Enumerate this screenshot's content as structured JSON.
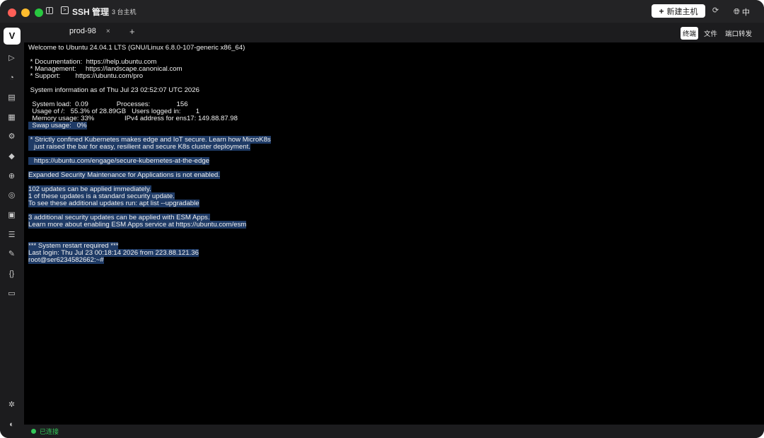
{
  "titlebar": {
    "app_title": "SSH 管理",
    "host_count": "3 台主机",
    "new_host_label": "新建主机",
    "language": "中"
  },
  "rail": {
    "logo": "V",
    "icons": [
      "play-icon",
      "clock-icon",
      "document-icon",
      "list-icon",
      "chip-icon",
      "docker-icon",
      "network-icon",
      "globe-icon",
      "terminal-icon",
      "server-icon",
      "edit-icon",
      "braces-icon",
      "file-icon",
      "settings-icon",
      "palette-icon"
    ]
  },
  "tabs": {
    "items": [
      {
        "label": "prod-98",
        "close": "×"
      }
    ],
    "add": "+"
  },
  "mode_tabs": [
    {
      "label": "终端",
      "active": true
    },
    {
      "label": "文件",
      "active": false
    },
    {
      "label": "端口转发",
      "active": false
    }
  ],
  "terminal": {
    "lines": [
      {
        "text": "Welcome to Ubuntu 24.04.1 LTS (GNU/Linux 6.8.0-107-generic x86_64)",
        "selected": false
      },
      {
        "text": "",
        "selected": false
      },
      {
        "text": " * Documentation:  https://help.ubuntu.com",
        "selected": false
      },
      {
        "text": " * Management:     https://landscape.canonical.com",
        "selected": false
      },
      {
        "text": " * Support:        https://ubuntu.com/pro",
        "selected": false
      },
      {
        "text": "",
        "selected": false
      },
      {
        "text": " System information as of Thu Jul 23 02:52:07 UTC 2026",
        "selected": false
      },
      {
        "text": "",
        "selected": false
      },
      {
        "text": "  System load:  0.09               Processes:              156",
        "selected": false
      },
      {
        "text": "  Usage of /:   55.3% of 28.89GB   Users logged in:        1",
        "selected": false
      },
      {
        "text": "  Memory usage: 33%                IPv4 address for ens17: 149.88.87.98",
        "selected": false
      },
      {
        "text": "  Swap usage:   0%",
        "selected": true
      },
      {
        "text": "",
        "selected": false
      },
      {
        "text": " * Strictly confined Kubernetes makes edge and IoT secure. Learn how MicroK8s",
        "selected": true
      },
      {
        "text": "   just raised the bar for easy, resilient and secure K8s cluster deployment.",
        "selected": true
      },
      {
        "text": "",
        "selected": false
      },
      {
        "text": "   https://ubuntu.com/engage/secure-kubernetes-at-the-edge",
        "selected": true
      },
      {
        "text": "",
        "selected": false
      },
      {
        "text": "Expanded Security Maintenance for Applications is not enabled.",
        "selected": true
      },
      {
        "text": "",
        "selected": false
      },
      {
        "text": "102 updates can be applied immediately.",
        "selected": true
      },
      {
        "text": "1 of these updates is a standard security update.",
        "selected": true
      },
      {
        "text": "To see these additional updates run: apt list --upgradable",
        "selected": true
      },
      {
        "text": "",
        "selected": false
      },
      {
        "text": "3 additional security updates can be applied with ESM Apps.",
        "selected": true
      },
      {
        "text": "Learn more about enabling ESM Apps service at https://ubuntu.com/esm",
        "selected": true
      },
      {
        "text": "",
        "selected": false
      },
      {
        "text": "",
        "selected": false
      },
      {
        "text": "*** System restart required ***",
        "selected": true
      },
      {
        "text": "Last login: Thu Jul 23 00:18:14 2026 from 223.88.121.36",
        "selected": true
      },
      {
        "text": "root@ser6234582662:~#",
        "selected": true
      }
    ]
  },
  "status": {
    "text": "已连接",
    "color": "#34c759"
  },
  "colors": {
    "selection": "#1f3b66",
    "terminal_bg": "#000000",
    "chrome_bg": "#1c1c1e"
  }
}
